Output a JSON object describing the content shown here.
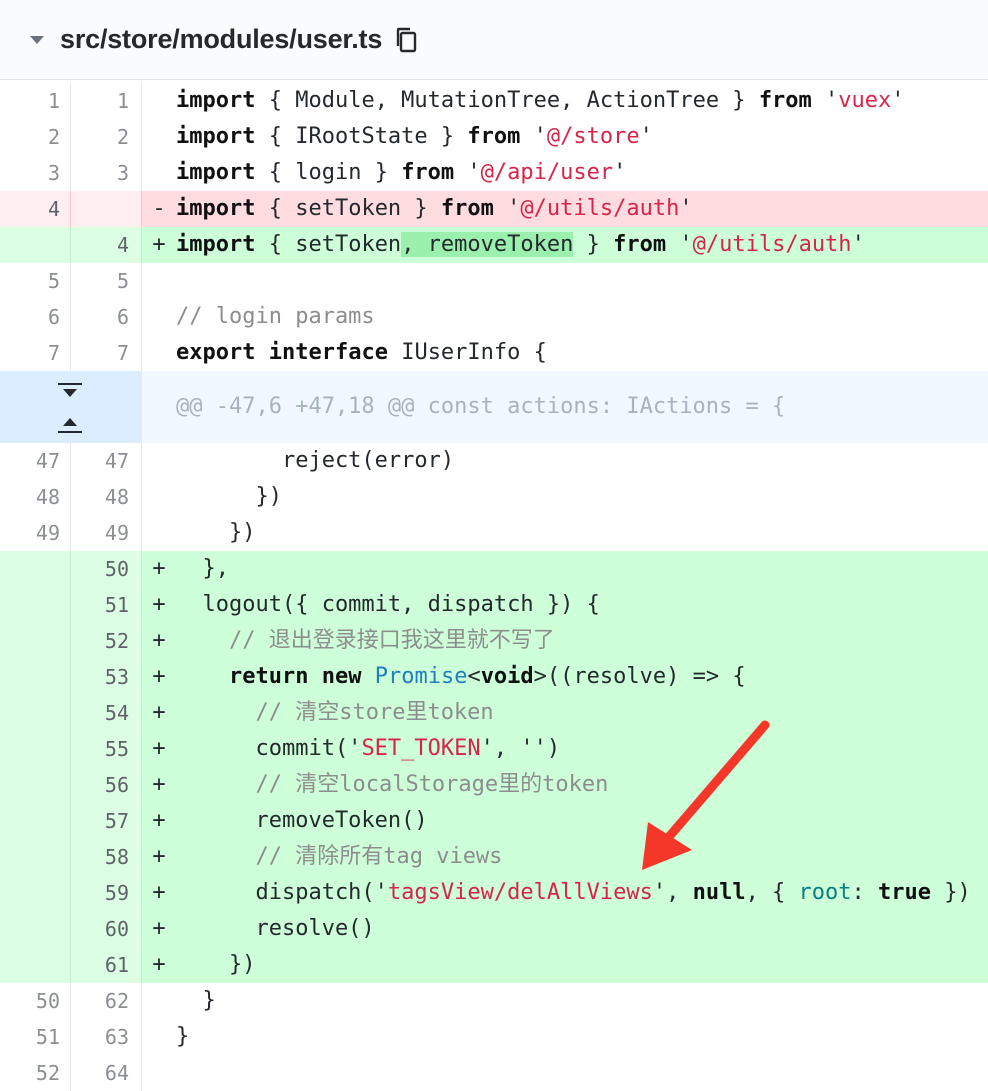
{
  "file_header": {
    "path": "src/store/modules/user.ts",
    "collapse_icon": "triangle-down-icon",
    "copy_icon": "copy-icon"
  },
  "hunk": {
    "header": "@@ -47,6 +47,18 @@ const actions: IActions = {",
    "expand_down_icon": "expand-down-icon",
    "expand_up_icon": "expand-up-icon"
  },
  "lines": [
    {
      "old": "1",
      "new": "1",
      "marker": " ",
      "tokens": [
        {
          "t": "import",
          "c": "k"
        },
        {
          "t": " { Module, MutationTree, ActionTree } "
        },
        {
          "t": "from",
          "c": "k"
        },
        {
          "t": " '"
        },
        {
          "t": "vuex",
          "c": "s"
        },
        {
          "t": "'"
        }
      ]
    },
    {
      "old": "2",
      "new": "2",
      "marker": " ",
      "tokens": [
        {
          "t": "import",
          "c": "k"
        },
        {
          "t": " { IRootState } "
        },
        {
          "t": "from",
          "c": "k"
        },
        {
          "t": " '"
        },
        {
          "t": "@/store",
          "c": "s"
        },
        {
          "t": "'"
        }
      ]
    },
    {
      "old": "3",
      "new": "3",
      "marker": " ",
      "tokens": [
        {
          "t": "import",
          "c": "k"
        },
        {
          "t": " { login } "
        },
        {
          "t": "from",
          "c": "k"
        },
        {
          "t": " '"
        },
        {
          "t": "@/api/user",
          "c": "s"
        },
        {
          "t": "'"
        }
      ]
    },
    {
      "old": "4",
      "new": "",
      "marker": "-",
      "type": "del",
      "tokens": [
        {
          "t": "import",
          "c": "k"
        },
        {
          "t": " { setToken } "
        },
        {
          "t": "from",
          "c": "k"
        },
        {
          "t": " '"
        },
        {
          "t": "@/utils/auth",
          "c": "s"
        },
        {
          "t": "'"
        }
      ]
    },
    {
      "old": "",
      "new": "4",
      "marker": "+",
      "type": "add",
      "tokens": [
        {
          "t": "import",
          "c": "k"
        },
        {
          "t": " { setToken"
        },
        {
          "t": ", removeToken",
          "c": "hl"
        },
        {
          "t": " } "
        },
        {
          "t": "from",
          "c": "k"
        },
        {
          "t": " '"
        },
        {
          "t": "@/utils/auth",
          "c": "s"
        },
        {
          "t": "'"
        }
      ]
    },
    {
      "old": "5",
      "new": "5",
      "marker": " ",
      "tokens": []
    },
    {
      "old": "6",
      "new": "6",
      "marker": " ",
      "tokens": [
        {
          "t": "// login params",
          "c": "c"
        }
      ]
    },
    {
      "old": "7",
      "new": "7",
      "marker": " ",
      "tokens": [
        {
          "t": "export",
          "c": "k"
        },
        {
          "t": " "
        },
        {
          "t": "interface",
          "c": "k"
        },
        {
          "t": " IUserInfo {"
        }
      ]
    },
    {
      "type": "hunk"
    },
    {
      "old": "47",
      "new": "47",
      "marker": " ",
      "tokens": [
        {
          "t": "        reject(error)"
        }
      ]
    },
    {
      "old": "48",
      "new": "48",
      "marker": " ",
      "tokens": [
        {
          "t": "      })"
        }
      ]
    },
    {
      "old": "49",
      "new": "49",
      "marker": " ",
      "tokens": [
        {
          "t": "    })"
        }
      ]
    },
    {
      "old": "",
      "new": "50",
      "marker": "+",
      "type": "add",
      "tokens": [
        {
          "t": "  },"
        }
      ]
    },
    {
      "old": "",
      "new": "51",
      "marker": "+",
      "type": "add",
      "tokens": [
        {
          "t": "  logout({ commit, dispatch }) {"
        }
      ]
    },
    {
      "old": "",
      "new": "52",
      "marker": "+",
      "type": "add",
      "tokens": [
        {
          "t": "    "
        },
        {
          "t": "// 退出登录接口我这里就不写了",
          "c": "c"
        }
      ]
    },
    {
      "old": "",
      "new": "53",
      "marker": "+",
      "type": "add",
      "tokens": [
        {
          "t": "    "
        },
        {
          "t": "return",
          "c": "k"
        },
        {
          "t": " "
        },
        {
          "t": "new",
          "c": "k"
        },
        {
          "t": " "
        },
        {
          "t": "Promise",
          "c": "t"
        },
        {
          "t": "<"
        },
        {
          "t": "void",
          "c": "k"
        },
        {
          "t": ">((resolve) => {"
        }
      ]
    },
    {
      "old": "",
      "new": "54",
      "marker": "+",
      "type": "add",
      "tokens": [
        {
          "t": "      "
        },
        {
          "t": "// 清空store里token",
          "c": "c"
        }
      ]
    },
    {
      "old": "",
      "new": "55",
      "marker": "+",
      "type": "add",
      "tokens": [
        {
          "t": "      commit('"
        },
        {
          "t": "SET_TOKEN",
          "c": "s"
        },
        {
          "t": "', '')"
        }
      ]
    },
    {
      "old": "",
      "new": "56",
      "marker": "+",
      "type": "add",
      "tokens": [
        {
          "t": "      "
        },
        {
          "t": "// 清空localStorage里的token",
          "c": "c"
        }
      ]
    },
    {
      "old": "",
      "new": "57",
      "marker": "+",
      "type": "add",
      "tokens": [
        {
          "t": "      removeToken()"
        }
      ]
    },
    {
      "old": "",
      "new": "58",
      "marker": "+",
      "type": "add",
      "tokens": [
        {
          "t": "      "
        },
        {
          "t": "// 清除所有tag views",
          "c": "c"
        }
      ]
    },
    {
      "old": "",
      "new": "59",
      "marker": "+",
      "type": "add",
      "tokens": [
        {
          "t": "      dispatch('"
        },
        {
          "t": "tagsView/delAllViews",
          "c": "s"
        },
        {
          "t": "', "
        },
        {
          "t": "null",
          "c": "k"
        },
        {
          "t": ", { "
        },
        {
          "t": "root",
          "c": "p"
        },
        {
          "t": ": "
        },
        {
          "t": "true",
          "c": "k"
        },
        {
          "t": " })"
        }
      ]
    },
    {
      "old": "",
      "new": "60",
      "marker": "+",
      "type": "add",
      "tokens": [
        {
          "t": "      resolve()"
        }
      ]
    },
    {
      "old": "",
      "new": "61",
      "marker": "+",
      "type": "add",
      "tokens": [
        {
          "t": "    })"
        }
      ]
    },
    {
      "old": "50",
      "new": "62",
      "marker": " ",
      "tokens": [
        {
          "t": "  }"
        }
      ]
    },
    {
      "old": "51",
      "new": "63",
      "marker": " ",
      "tokens": [
        {
          "t": "}"
        }
      ]
    },
    {
      "old": "52",
      "new": "64",
      "marker": " ",
      "tokens": []
    }
  ],
  "annotation": {
    "arrow_color": "#f5372a",
    "arrow_icon": "red-arrow-icon"
  }
}
